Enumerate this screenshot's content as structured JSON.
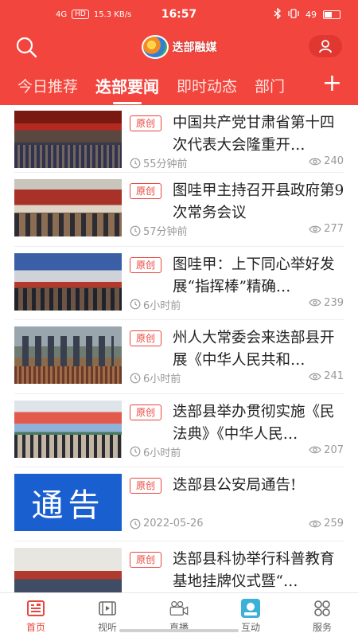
{
  "status_bar": {
    "network_left": "4G",
    "hd_badge": "HD",
    "speed": "15.3 KB/s",
    "time": "16:57",
    "battery": "49"
  },
  "header": {
    "logo_text": "迭部融媒",
    "search_icon": "search-icon",
    "user_icon": "user-icon",
    "accent_color": "#f2453d"
  },
  "tabs": [
    {
      "label": "今日推荐",
      "active": false
    },
    {
      "label": "迭部要闻",
      "active": true
    },
    {
      "label": "即时动态",
      "active": false
    },
    {
      "label": "部门",
      "active": false
    }
  ],
  "add_tab_label": "+",
  "news": [
    {
      "badge": "原创",
      "title": "中国共产党甘肃省第十四次代表大会隆重开…",
      "time": "55分钟前",
      "views": "240"
    },
    {
      "badge": "原创",
      "title": "图哇甲主持召开县政府第9次常务会议",
      "time": "57分钟前",
      "views": "277"
    },
    {
      "badge": "原创",
      "title": "图哇甲：上下同心举好发展“指挥棒”精确…",
      "time": "6小时前",
      "views": "239"
    },
    {
      "badge": "原创",
      "title": "州人大常委会来迭部县开展《中华人民共和…",
      "time": "6小时前",
      "views": "241"
    },
    {
      "badge": "原创",
      "title": "迭部县举办贯彻实施《民法典》《中华人民…",
      "time": "6小时前",
      "views": "207"
    },
    {
      "badge": "原创",
      "title": "迭部县公安局通告!",
      "time": "2022-05-26",
      "views": "259",
      "thumb_text": "通告"
    },
    {
      "badge": "原创",
      "title": "迭部县科协举行科普教育基地挂牌仪式暨“…",
      "time": "",
      "views": ""
    }
  ],
  "bottom_nav": [
    {
      "label": "首页",
      "icon": "news-icon",
      "active": true
    },
    {
      "label": "视听",
      "icon": "video-icon",
      "active": false
    },
    {
      "label": "直播",
      "icon": "camera-icon",
      "active": false
    },
    {
      "label": "互动",
      "icon": "interact-icon",
      "active": false
    },
    {
      "label": "服务",
      "icon": "service-icon",
      "active": false
    }
  ]
}
